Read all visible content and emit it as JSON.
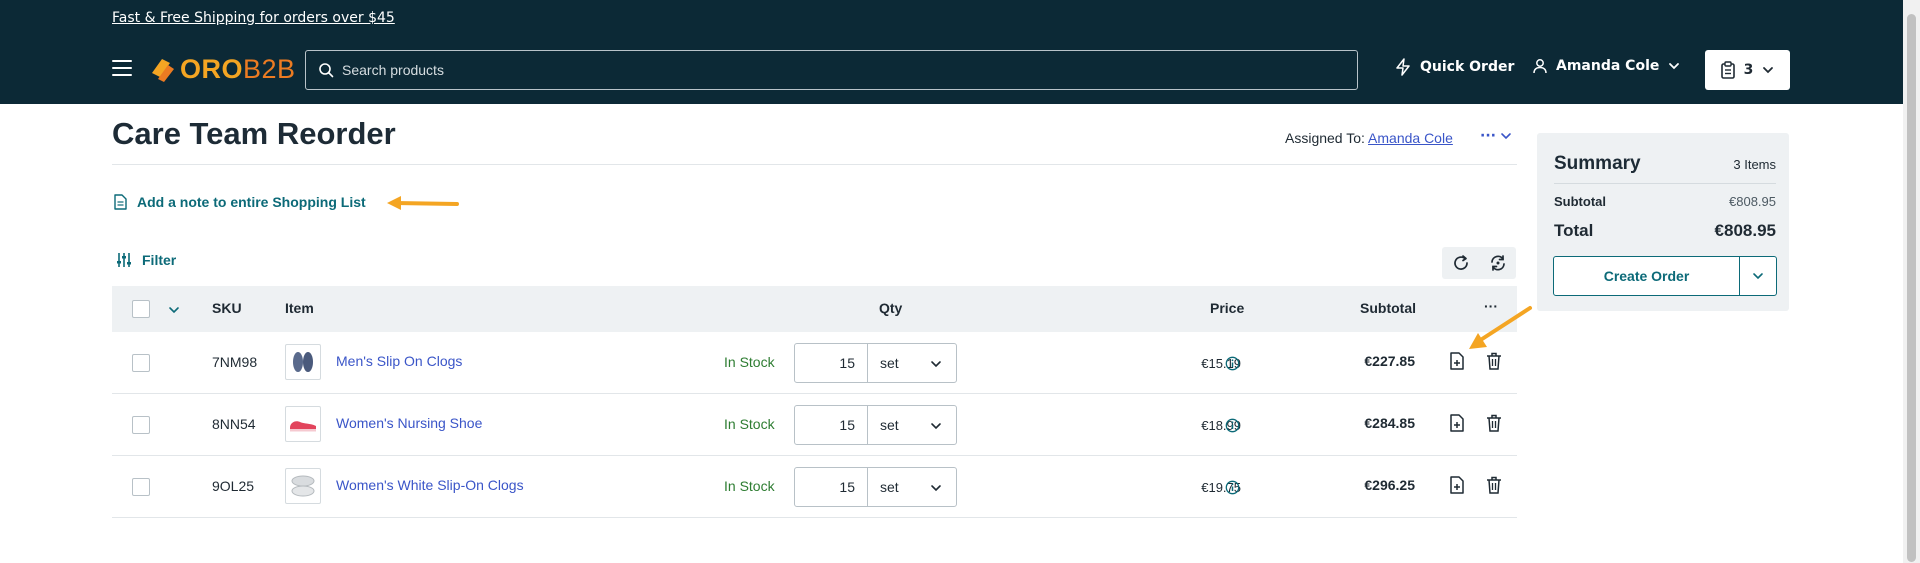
{
  "header": {
    "promo": "Fast & Free Shipping for orders over $45",
    "logo_oro": "ORO",
    "logo_b2b": "B2B",
    "search_placeholder": "Search products",
    "quick_order": "Quick Order",
    "user_name": "Amanda Cole",
    "cart_count": "3"
  },
  "page": {
    "title": "Care Team Reorder",
    "assigned_label": "Assigned To:",
    "assigned_user": "Amanda Cole",
    "more_actions": "···",
    "add_note": "Add a note to entire Shopping List",
    "filter": "Filter"
  },
  "table": {
    "headers": {
      "sku": "SKU",
      "item": "Item",
      "qty": "Qty",
      "price": "Price",
      "subtotal": "Subtotal",
      "actions": "···"
    },
    "rows": [
      {
        "sku": "7NM98",
        "name": "Men's Slip On Clogs",
        "stock": "In Stock",
        "qty": "15",
        "unit": "set",
        "price": "€15.19",
        "subtotal": "€227.85",
        "thumb_color": "#5a6a8c"
      },
      {
        "sku": "8NN54",
        "name": "Women's Nursing Shoe",
        "stock": "In Stock",
        "qty": "15",
        "unit": "set",
        "price": "€18.99",
        "subtotal": "€284.85",
        "thumb_color": "#e2445c"
      },
      {
        "sku": "9OL25",
        "name": "Women's White Slip-On Clogs",
        "stock": "In Stock",
        "qty": "15",
        "unit": "set",
        "price": "€19.75",
        "subtotal": "€296.25",
        "thumb_color": "#c9cdd1"
      }
    ]
  },
  "summary": {
    "title": "Summary",
    "items_count": "3 Items",
    "subtotal_label": "Subtotal",
    "subtotal_value": "€808.95",
    "total_label": "Total",
    "total_value": "€808.95",
    "create_order": "Create Order"
  },
  "colors": {
    "header_bg": "#0c2936",
    "accent_teal": "#0c6a78",
    "link_blue": "#3a55c8",
    "in_stock": "#2e7d32",
    "annotation_arrow": "#f4a523"
  },
  "icons": [
    "hamburger-icon",
    "search-icon",
    "lightning-icon",
    "user-icon",
    "chevron-down-icon",
    "clipboard-icon",
    "note-icon",
    "filter-icon",
    "refresh-icon",
    "sync-icon",
    "info-icon",
    "add-note-icon",
    "trash-icon"
  ]
}
